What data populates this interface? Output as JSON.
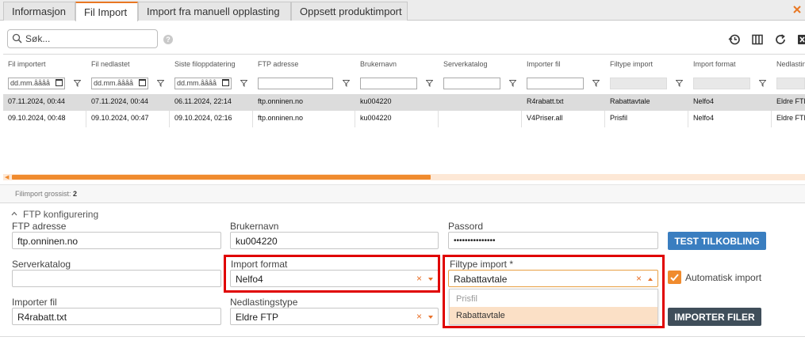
{
  "tabs": [
    {
      "label": "Informasjon",
      "active": false
    },
    {
      "label": "Fil Import",
      "active": true
    },
    {
      "label": "Import fra manuell opplasting",
      "active": false
    },
    {
      "label": "Oppsett produktimport",
      "active": false
    }
  ],
  "toolbar": {
    "search_placeholder": "Søk...",
    "help_label": "?",
    "icons": [
      "history-icon",
      "columns-icon",
      "refresh-icon",
      "excel-export-icon"
    ]
  },
  "grid": {
    "columns": [
      "Fil importert",
      "Fil nedlastet",
      "Siste filoppdatering",
      "FTP adresse",
      "Brukernavn",
      "Serverkatalog",
      "Importer fil",
      "Filtype import",
      "Import format",
      "Nedlastingstype"
    ],
    "date_placeholder": "dd.mm.åååå",
    "rows": [
      {
        "selected": true,
        "cells": [
          "07.11.2024, 00:44",
          "07.11.2024, 00:44",
          "06.11.2024, 22:14",
          "ftp.onninen.no",
          "ku004220",
          "",
          "R4rabatt.txt",
          "Rabattavtale",
          "Nelfo4",
          "Eldre FTP"
        ]
      },
      {
        "selected": false,
        "cells": [
          "09.10.2024, 00:48",
          "09.10.2024, 00:47",
          "09.10.2024, 02:16",
          "ftp.onninen.no",
          "ku004220",
          "",
          "V4Priser.all",
          "Prisfil",
          "Nelfo4",
          "Eldre FTP"
        ]
      }
    ],
    "count_label": "Filimport grossist:",
    "count_value": "2"
  },
  "ftp_form": {
    "section_title": "FTP konfigurering",
    "ftp_address": {
      "label": "FTP adresse",
      "value": "ftp.onninen.no"
    },
    "username": {
      "label": "Brukernavn",
      "value": "ku004220"
    },
    "password": {
      "label": "Passord",
      "value": "•••••••••••••••"
    },
    "server_folder": {
      "label": "Serverkatalog",
      "value": ""
    },
    "import_format": {
      "label": "Import format",
      "value": "Nelfo4"
    },
    "file_type": {
      "label": "Filtype import *",
      "value": "Rabattavtale",
      "options": [
        "Prisfil",
        "Rabattavtale"
      ]
    },
    "import_file": {
      "label": "Importer fil",
      "value": "R4rabatt.txt"
    },
    "download_type": {
      "label": "Nedlastingstype",
      "value": "Eldre FTP"
    },
    "auto_import": {
      "label": "Automatisk import",
      "checked": true
    },
    "test_button": "TEST TILKOBLING",
    "import_button": "IMPORTER FILER",
    "clear_glyph": "×"
  },
  "colors": {
    "accent": "#f08b2e",
    "highlight": "#e00000",
    "blue_button": "#3a7ec0",
    "dark_button": "#3f4e5a"
  }
}
